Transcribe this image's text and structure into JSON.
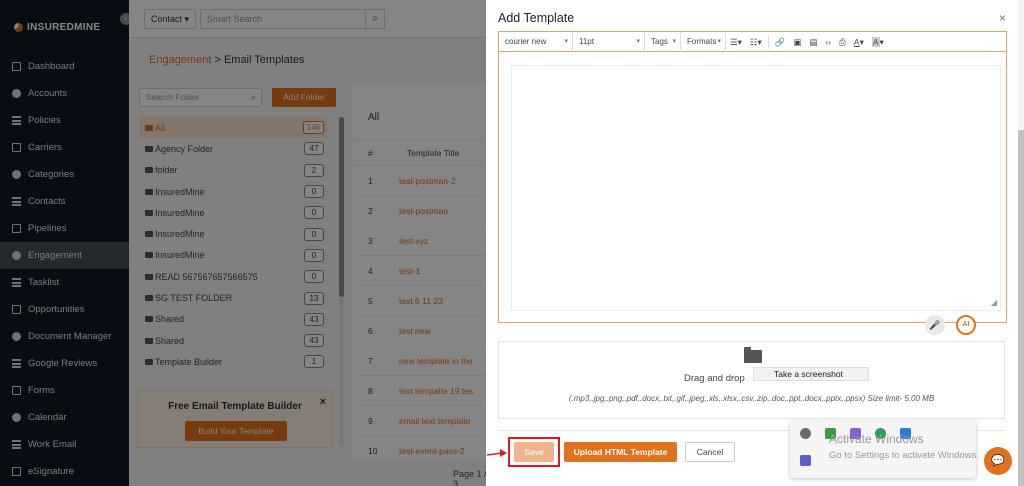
{
  "brand": "INSUREDMINE",
  "nav": [
    {
      "label": "Dashboard",
      "icon": "dashboard-icon"
    },
    {
      "label": "Accounts",
      "icon": "accounts-icon"
    },
    {
      "label": "Policies",
      "icon": "policies-icon"
    },
    {
      "label": "Carriers",
      "icon": "carriers-icon"
    },
    {
      "label": "Categories",
      "icon": "categories-icon"
    },
    {
      "label": "Contacts",
      "icon": "contacts-icon"
    },
    {
      "label": "Pipelines",
      "icon": "pipelines-icon"
    },
    {
      "label": "Engagement",
      "icon": "engagement-icon",
      "active": true
    },
    {
      "label": "Tasklist",
      "icon": "tasklist-icon"
    },
    {
      "label": "Opportunities",
      "icon": "opportunities-icon"
    },
    {
      "label": "Document Manager",
      "icon": "document-icon"
    },
    {
      "label": "Google Reviews",
      "icon": "google-icon"
    },
    {
      "label": "Forms",
      "icon": "forms-icon"
    },
    {
      "label": "Calendar",
      "icon": "calendar-icon"
    },
    {
      "label": "Work Email",
      "icon": "email-icon"
    },
    {
      "label": "eSignature",
      "icon": "signature-icon"
    }
  ],
  "topbar": {
    "contact_select": "Contact",
    "search_placeholder": "Smart Search"
  },
  "breadcrumb": {
    "section": "Engagement",
    "separator": " > ",
    "page": "Email Templates"
  },
  "folders": {
    "search_placeholder": "Search Folder",
    "add_label": "Add Folder",
    "items": [
      {
        "name": "All",
        "count": "146",
        "active": true
      },
      {
        "name": "Agency Folder",
        "count": "47"
      },
      {
        "name": "folder",
        "count": "2"
      },
      {
        "name": "InsuredMine",
        "count": "0"
      },
      {
        "name": "InsuredMine",
        "count": "0"
      },
      {
        "name": "InsuredMine",
        "count": "0"
      },
      {
        "name": "InsuredMine",
        "count": "0"
      },
      {
        "name": "READ 567567657566575",
        "count": "0"
      },
      {
        "name": "SG TEST FOLDER",
        "count": "13"
      },
      {
        "name": "Shared",
        "count": "43"
      },
      {
        "name": "Shared",
        "count": "43"
      },
      {
        "name": "Template Builder",
        "count": "1"
      }
    ]
  },
  "promo": {
    "title": "Free Email Template Builder",
    "close": "×",
    "button": "Build Your Template"
  },
  "table": {
    "title": "All",
    "headers": [
      "#",
      "Template Title"
    ],
    "rows": [
      {
        "num": "1",
        "title": "test-postman-2"
      },
      {
        "num": "2",
        "title": "test-postman"
      },
      {
        "num": "3",
        "title": "test-xyz"
      },
      {
        "num": "4",
        "title": "test-1"
      },
      {
        "num": "5",
        "title": "test 6 11 23"
      },
      {
        "num": "6",
        "title": "test new"
      },
      {
        "num": "7",
        "title": "new template in the"
      },
      {
        "num": "8",
        "title": "text tempalte 19 tes"
      },
      {
        "num": "9",
        "title": "email text template"
      },
      {
        "num": "10",
        "title": "test-event-pass-2"
      }
    ],
    "pager": "Page 1 / 3"
  },
  "modal": {
    "title": "Add Template",
    "close": "×",
    "toolbar": {
      "font": "courier new",
      "size": "11pt",
      "tags": "Tags",
      "formats": "Formats"
    },
    "upload": {
      "drag_text": "Drag and drop",
      "tooltip": "Take a screenshot",
      "types": "(.mp3,.jpg,.png,.pdf,.docx,.txt,.gif,.jpeg,.xls,.xlsx,.csv,.zip,.doc,.ppt,.docx,.pptx,.ppsx) Size limit- 5.00 MB"
    },
    "buttons": {
      "save": "Save",
      "upload_html": "Upload HTML Template",
      "cancel": "Cancel"
    },
    "ai_label": "AI"
  },
  "windows": {
    "title": "Activate Windows",
    "subtitle": "Go to Settings to activate Windows."
  },
  "colors": {
    "accent": "#e2711d",
    "sidebar": "#0f1a24",
    "highlight": "#e01b1b"
  }
}
